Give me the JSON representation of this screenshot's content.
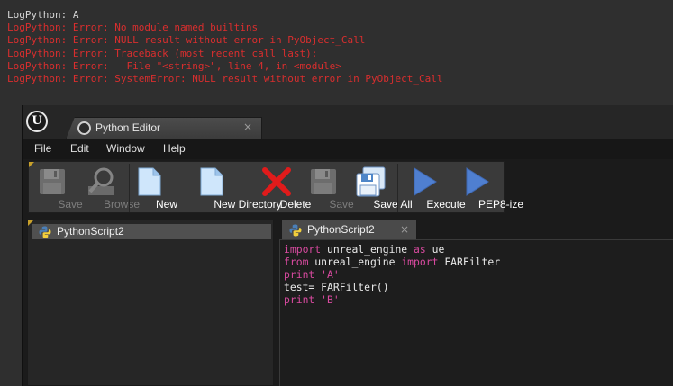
{
  "log": {
    "lines": [
      {
        "text": "LogPython: A",
        "kind": "info"
      },
      {
        "text": "LogPython: Error: No module named builtins",
        "kind": "err"
      },
      {
        "text": "LogPython: Error: NULL result without error in PyObject_Call",
        "kind": "err"
      },
      {
        "text": "LogPython: Error: Traceback (most recent call last):",
        "kind": "err"
      },
      {
        "text": "LogPython: Error:   File \"<string>\", line 4, in <module>",
        "kind": "err"
      },
      {
        "text": "LogPython: Error: SystemError: NULL result without error in PyObject_Call",
        "kind": "err"
      }
    ]
  },
  "window": {
    "tab_title": "Python Editor",
    "tab_close": "×",
    "logo_letter": "U"
  },
  "menu": {
    "items": [
      "File",
      "Edit",
      "Window",
      "Help"
    ]
  },
  "toolbar": {
    "save": "Save",
    "browse": "Browse",
    "new": "New",
    "new_directory": "New Directory",
    "delete": "Delete",
    "save2": "Save",
    "save_all": "Save All",
    "execute": "Execute",
    "pep8": "PEP8-ize"
  },
  "scripts_panel": {
    "items": [
      "PythonScript2"
    ]
  },
  "editor": {
    "tab_label": "PythonScript2",
    "tab_close": "×",
    "code": [
      [
        {
          "t": "import",
          "c": "kw"
        },
        {
          "t": " unreal_engine ",
          "c": ""
        },
        {
          "t": "as",
          "c": "kw"
        },
        {
          "t": " ue",
          "c": ""
        }
      ],
      [
        {
          "t": "from",
          "c": "kw"
        },
        {
          "t": " unreal_engine ",
          "c": ""
        },
        {
          "t": "import",
          "c": "kw"
        },
        {
          "t": " FARFilter",
          "c": ""
        }
      ],
      [
        {
          "t": "print",
          "c": "kw"
        },
        {
          "t": " ",
          "c": ""
        },
        {
          "t": "'A'",
          "c": "str"
        }
      ],
      [
        {
          "t": "test= FARFilter()",
          "c": ""
        }
      ],
      [
        {
          "t": "print",
          "c": "kw"
        },
        {
          "t": " ",
          "c": ""
        },
        {
          "t": "'B'",
          "c": "str"
        }
      ]
    ]
  },
  "colors": {
    "error_text": "#d92e2e",
    "keyword": "#d94aa0",
    "toolbar_bg": "#3a3a3a",
    "accent_corner": "#c8a02a"
  }
}
